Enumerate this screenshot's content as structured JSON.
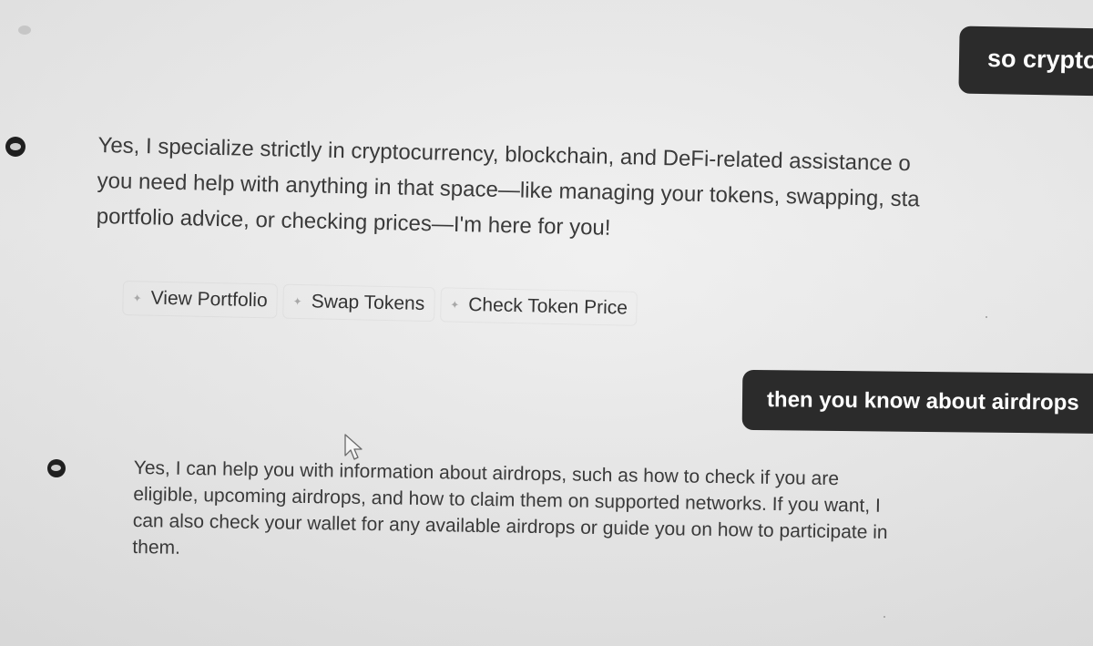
{
  "conversation": {
    "user_messages": [
      {
        "text": "so crypto"
      },
      {
        "text": "then you know about airdrops"
      }
    ],
    "assistant_messages": [
      {
        "lines": [
          "Yes, I specialize strictly in cryptocurrency, blockchain, and DeFi-related assistance o",
          "you need help with anything in that space—like managing your tokens, swapping, sta",
          "portfolio advice, or checking prices—I'm here for you!"
        ]
      },
      {
        "lines": [
          "Yes, I can help you with information about airdrops, such as how to check if you are",
          "eligible, upcoming airdrops, and how to claim them on supported networks. If you want, I",
          "can also check your wallet for any available airdrops or guide you on how to participate in",
          "them."
        ]
      }
    ],
    "suggestions": [
      {
        "label": "View Portfolio",
        "icon": "sparkle-icon"
      },
      {
        "label": "Swap Tokens",
        "icon": "sparkle-icon"
      },
      {
        "label": "Check Token Price",
        "icon": "sparkle-icon"
      }
    ]
  },
  "colors": {
    "background": "#e9e9e9",
    "user_bubble": "#2b2b2b",
    "user_text": "#ffffff",
    "assistant_text": "#3a3a3a"
  }
}
